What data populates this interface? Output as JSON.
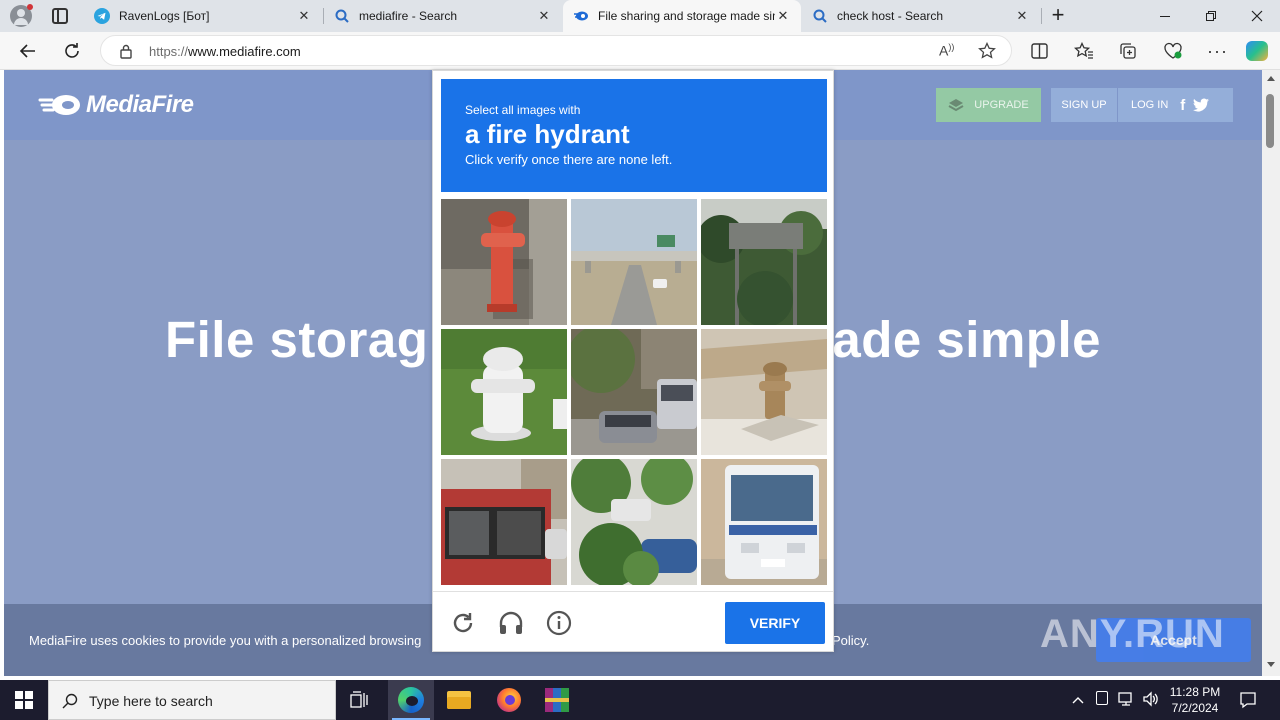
{
  "browser": {
    "tabs": [
      {
        "title": "RavenLogs [Бот]",
        "icon": "telegram-icon",
        "active": false
      },
      {
        "title": "mediafire - Search",
        "icon": "search-icon",
        "active": false
      },
      {
        "title": "File sharing and storage made simple",
        "icon": "mediafire-icon",
        "active": true
      },
      {
        "title": "check host - Search",
        "icon": "search-icon",
        "active": false
      }
    ],
    "url_prefix": "https://",
    "url_host": "www.mediafire.com",
    "close_glyph": "✕",
    "new_tab_glyph": "+"
  },
  "site": {
    "logo_text": "MediaFire",
    "upgrade_label": "UPGRADE",
    "signup_label": "SIGN UP",
    "login_label": "LOG IN",
    "hero_left": "File storag",
    "hero_right": "ade simple",
    "cookie_text": "MediaFire uses cookies to provide you with a personalized browsing",
    "cookie_text_end": "Policy.",
    "accept_label": "Accept"
  },
  "captcha": {
    "instruction_small": "Select all images with",
    "target": "a fire hydrant",
    "instruction_note": "Click verify once there are none left.",
    "verify_label": "VERIFY",
    "tiles": [
      "red fire hydrant",
      "highway overpass",
      "road sign gantry",
      "white fire hydrant",
      "street with cars",
      "rusty fire hydrant in snow",
      "bus interior side",
      "car behind tree",
      "white bus"
    ]
  },
  "watermark": "ANY.RUN",
  "taskbar": {
    "search_placeholder": "Type here to search",
    "time": "11:28 PM",
    "date": "7/2/2024"
  }
}
